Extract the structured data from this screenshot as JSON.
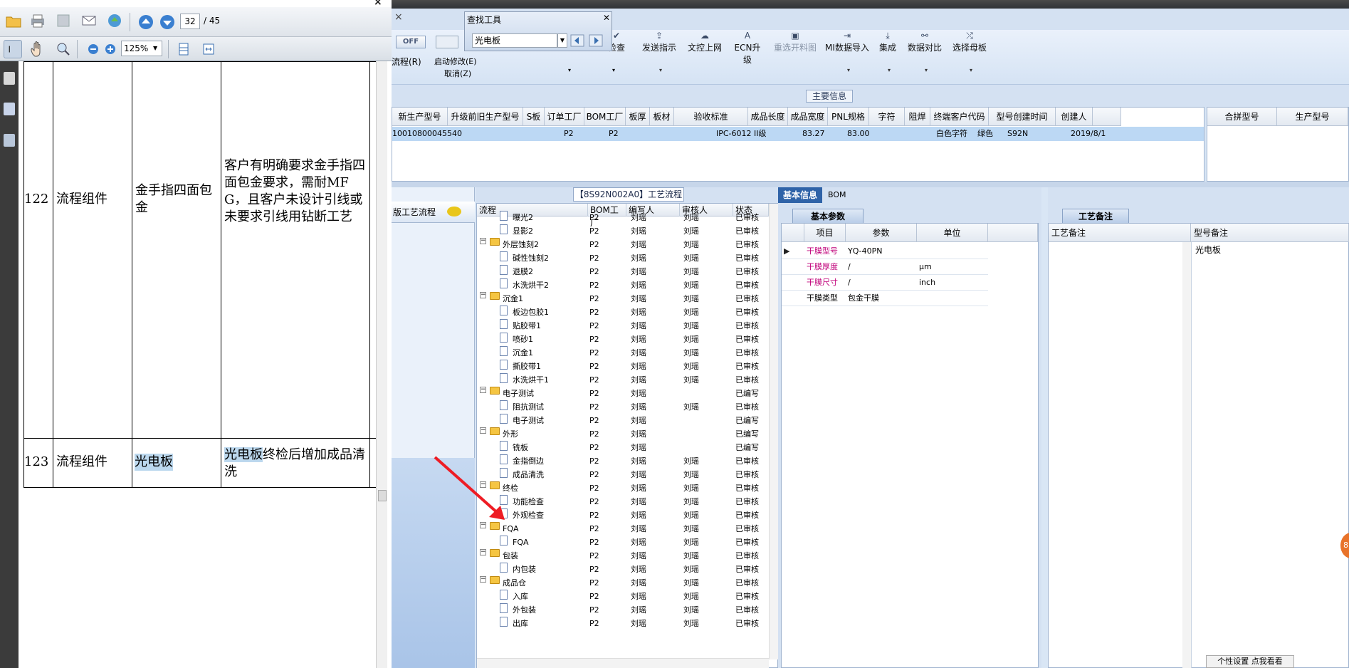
{
  "pdf": {
    "page_current": "32",
    "page_total": "/ 45",
    "zoom": "125%",
    "rows": [
      {
        "no": "122",
        "category": "流程组件",
        "item": "金手指四面包金",
        "desc": "客户有明确要求金手指四面包金要求，需耐MFG，且客户未设计引线或未要求引线用钻断工艺"
      },
      {
        "no": "123",
        "category": "流程组件",
        "item": "光电板",
        "desc_hl": "光电板",
        "desc_rest": "终检后增加成品清洗"
      }
    ]
  },
  "find_tool": {
    "title": "查找工具",
    "value": "光电板"
  },
  "app": {
    "off_label": "OFF",
    "left_labels": [
      "流程(R)",
      "启动修改(E)",
      "取消(Z)"
    ],
    "toolbar": [
      "检查",
      "发送指示",
      "文控上网",
      "ECN升级",
      "重选开料图",
      "MI数据导入",
      "集成",
      "数据对比",
      "选择母板"
    ],
    "main_info_tab": "主要信息",
    "main_headers": [
      "新生产型号",
      "升级前旧生产型号",
      "S板",
      "订单工厂",
      "BOM工厂",
      "板厚",
      "板材",
      "验收标准",
      "成品长度",
      "成品宽度",
      "PNL规格",
      "字符",
      "阻焊",
      "终端客户代码",
      "型号创建时间",
      "创建人"
    ],
    "main_row": {
      "new_model": "10010800045540",
      "order_factory": "P2",
      "bom_factory": "P2",
      "standard": "IPC-6012 II级",
      "length": "83.27",
      "width": "83.00",
      "char": "白色字符",
      "solder": "绿色",
      "client": "S92N",
      "created": "2019/8/1"
    },
    "merge_headers": [
      "合拼型号",
      "生产型号"
    ],
    "left_pane_label": "版工艺流程",
    "process_tab": "【8S92N002A0】工艺流程",
    "process_headers": [
      "流程",
      "BOM工厂",
      "编写人",
      "审核人",
      "状态"
    ],
    "process_rows": [
      {
        "level": 2,
        "kind": "doc",
        "name": "曝光2",
        "bom": "P2",
        "writer": "刘瑶",
        "auditor": "刘瑶",
        "status": "已审核"
      },
      {
        "level": 2,
        "kind": "doc",
        "name": "显影2",
        "bom": "P2",
        "writer": "刘瑶",
        "auditor": "刘瑶",
        "status": "已审核"
      },
      {
        "level": 1,
        "kind": "folder",
        "name": "外层蚀刻2",
        "bom": "P2",
        "writer": "刘瑶",
        "auditor": "刘瑶",
        "status": "已审核"
      },
      {
        "level": 2,
        "kind": "doc",
        "name": "碱性蚀刻2",
        "bom": "P2",
        "writer": "刘瑶",
        "auditor": "刘瑶",
        "status": "已审核"
      },
      {
        "level": 2,
        "kind": "doc",
        "name": "退膜2",
        "bom": "P2",
        "writer": "刘瑶",
        "auditor": "刘瑶",
        "status": "已审核"
      },
      {
        "level": 2,
        "kind": "doc",
        "name": "水洗烘干2",
        "bom": "P2",
        "writer": "刘瑶",
        "auditor": "刘瑶",
        "status": "已审核"
      },
      {
        "level": 1,
        "kind": "folder",
        "name": "沉金1",
        "bom": "P2",
        "writer": "刘瑶",
        "auditor": "刘瑶",
        "status": "已审核"
      },
      {
        "level": 2,
        "kind": "doc",
        "name": "板边包胶1",
        "bom": "P2",
        "writer": "刘瑶",
        "auditor": "刘瑶",
        "status": "已审核"
      },
      {
        "level": 2,
        "kind": "doc",
        "name": "贴胶带1",
        "bom": "P2",
        "writer": "刘瑶",
        "auditor": "刘瑶",
        "status": "已审核"
      },
      {
        "level": 2,
        "kind": "doc",
        "name": "喷砂1",
        "bom": "P2",
        "writer": "刘瑶",
        "auditor": "刘瑶",
        "status": "已审核"
      },
      {
        "level": 2,
        "kind": "doc",
        "name": "沉金1",
        "bom": "P2",
        "writer": "刘瑶",
        "auditor": "刘瑶",
        "status": "已审核"
      },
      {
        "level": 2,
        "kind": "doc",
        "name": "撕胶带1",
        "bom": "P2",
        "writer": "刘瑶",
        "auditor": "刘瑶",
        "status": "已审核"
      },
      {
        "level": 2,
        "kind": "doc",
        "name": "水洗烘干1",
        "bom": "P2",
        "writer": "刘瑶",
        "auditor": "刘瑶",
        "status": "已审核"
      },
      {
        "level": 1,
        "kind": "folder",
        "name": "电子测试",
        "bom": "P2",
        "writer": "刘瑶",
        "auditor": "",
        "status": "已编写"
      },
      {
        "level": 2,
        "kind": "doc",
        "name": "阻抗测试",
        "bom": "P2",
        "writer": "刘瑶",
        "auditor": "刘瑶",
        "status": "已审核"
      },
      {
        "level": 2,
        "kind": "doc",
        "name": "电子测试",
        "bom": "P2",
        "writer": "刘瑶",
        "auditor": "",
        "status": "已编写"
      },
      {
        "level": 1,
        "kind": "folder",
        "name": "外形",
        "bom": "P2",
        "writer": "刘瑶",
        "auditor": "",
        "status": "已编写"
      },
      {
        "level": 2,
        "kind": "doc",
        "name": "铣板",
        "bom": "P2",
        "writer": "刘瑶",
        "auditor": "",
        "status": "已编写"
      },
      {
        "level": 2,
        "kind": "doc",
        "name": "金指倒边",
        "bom": "P2",
        "writer": "刘瑶",
        "auditor": "刘瑶",
        "status": "已审核"
      },
      {
        "level": 2,
        "kind": "doc",
        "name": "成品清洗",
        "bom": "P2",
        "writer": "刘瑶",
        "auditor": "刘瑶",
        "status": "已审核"
      },
      {
        "level": 1,
        "kind": "folder",
        "name": "终检",
        "bom": "P2",
        "writer": "刘瑶",
        "auditor": "刘瑶",
        "status": "已审核"
      },
      {
        "level": 2,
        "kind": "doc",
        "name": "功能检查",
        "bom": "P2",
        "writer": "刘瑶",
        "auditor": "刘瑶",
        "status": "已审核"
      },
      {
        "level": 2,
        "kind": "doc",
        "name": "外观检查",
        "bom": "P2",
        "writer": "刘瑶",
        "auditor": "刘瑶",
        "status": "已审核"
      },
      {
        "level": 1,
        "kind": "folder",
        "name": "FQA",
        "bom": "P2",
        "writer": "刘瑶",
        "auditor": "刘瑶",
        "status": "已审核"
      },
      {
        "level": 2,
        "kind": "doc",
        "name": "FQA",
        "bom": "P2",
        "writer": "刘瑶",
        "auditor": "刘瑶",
        "status": "已审核"
      },
      {
        "level": 1,
        "kind": "folder",
        "name": "包装",
        "bom": "P2",
        "writer": "刘瑶",
        "auditor": "刘瑶",
        "status": "已审核"
      },
      {
        "level": 2,
        "kind": "doc",
        "name": "内包装",
        "bom": "P2",
        "writer": "刘瑶",
        "auditor": "刘瑶",
        "status": "已审核"
      },
      {
        "level": 1,
        "kind": "folder",
        "name": "成品仓",
        "bom": "P2",
        "writer": "刘瑶",
        "auditor": "刘瑶",
        "status": "已审核"
      },
      {
        "level": 2,
        "kind": "doc",
        "name": "入库",
        "bom": "P2",
        "writer": "刘瑶",
        "auditor": "刘瑶",
        "status": "已审核"
      },
      {
        "level": 2,
        "kind": "doc",
        "name": "外包装",
        "bom": "P2",
        "writer": "刘瑶",
        "auditor": "刘瑶",
        "status": "已审核"
      },
      {
        "level": 2,
        "kind": "doc",
        "name": "出库",
        "bom": "P2",
        "writer": "刘瑶",
        "auditor": "刘瑶",
        "status": "已审核"
      }
    ],
    "basic_tab": "基本信息",
    "bom_tab": "BOM",
    "basic_sub": "基本参数",
    "basic_headers": [
      "项目",
      "参数",
      "单位"
    ],
    "basic_rows": [
      {
        "item": "干膜型号",
        "param": "YQ-40PN",
        "unit": "",
        "red": true
      },
      {
        "item": "干膜厚度",
        "param": "/",
        "unit": "μm",
        "red": true
      },
      {
        "item": "干膜尺寸",
        "param": "/",
        "unit": "inch",
        "red": true
      },
      {
        "item": "干膜类型",
        "param": "包金干膜",
        "unit": "",
        "red": false
      }
    ],
    "craft_tab": "工艺备注",
    "craft_headers": [
      "工艺备注",
      "型号备注"
    ],
    "model_remark": "光电板",
    "bottom_popup": "个性设置  点我看看",
    "orange_text": "8"
  },
  "colors": {
    "highlight": "#bcd8ee",
    "selected_row": "#bcd8f4",
    "red_label": "#c0007a",
    "tab_blue": "#2f63a8"
  }
}
